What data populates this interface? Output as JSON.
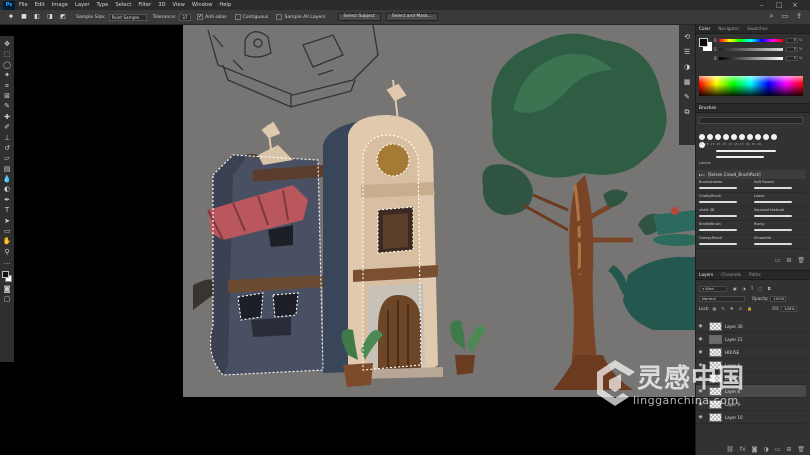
{
  "menu": {
    "logo": "Ps",
    "items": [
      "File",
      "Edit",
      "Image",
      "Layer",
      "Type",
      "Select",
      "Filter",
      "3D",
      "View",
      "Window",
      "Help"
    ]
  },
  "options": {
    "sample_size_label": "Sample Size:",
    "sample_size_value": "Point Sample",
    "tolerance_label": "Tolerance:",
    "tolerance_value": "37",
    "anti_alias_label": "Anti-alias",
    "contiguous_label": "Contiguous",
    "sample_all_layers_label": "Sample All Layers",
    "select_subject_label": "Select Subject",
    "select_and_mask_label": "Select and Mask..."
  },
  "color_panel": {
    "tabs": [
      "Color",
      "Navigator",
      "Swatches"
    ],
    "sliders": [
      {
        "label": "R",
        "value": "0"
      },
      {
        "label": "S",
        "value": "0"
      },
      {
        "label": "B",
        "value": "0"
      }
    ],
    "unit": "%"
  },
  "brushes_panel": {
    "tab": "Brushes",
    "preset_values": [
      "15",
      "15",
      "15",
      "15",
      "15",
      "15",
      "15",
      "15",
      "30",
      "30",
      "30"
    ],
    "group_label": "Labels",
    "subgroup": "[Kelsen Crowd_BrushPack]",
    "rows": [
      [
        "Brushstrokes",
        "Soft Round"
      ],
      [
        "ChalkyBrush",
        "Loose"
      ],
      [
        "chalk 38",
        "Squared textural"
      ],
      [
        "BristleBrush",
        "Rocky"
      ],
      [
        "GreasyPencil",
        "Smoothie"
      ]
    ]
  },
  "layers_panel": {
    "tabs": [
      "Layers",
      "Channels",
      "Paths"
    ],
    "filter_label": "Kind",
    "blend_mode": "Normal",
    "opacity_label": "Opacity:",
    "opacity_value": "100%",
    "lock_label": "Lock:",
    "fill_label": "Fill:",
    "fill_value": "100%",
    "layers": [
      {
        "name": "Layer 30",
        "selected": false,
        "dark": false
      },
      {
        "name": "Layer 21",
        "selected": false,
        "dark": true
      },
      {
        "name": "HOUSE",
        "selected": false,
        "dark": false
      },
      {
        "name": "Layer 6",
        "selected": false,
        "dark": false
      },
      {
        "name": "Layer 7",
        "selected": false,
        "dark": false
      },
      {
        "name": "Layer 8",
        "selected": true,
        "dark": false
      },
      {
        "name": "Layer 9",
        "selected": false,
        "dark": false
      },
      {
        "name": "Layer 10",
        "selected": false,
        "dark": false
      }
    ]
  },
  "watermark": {
    "title": "灵感中国",
    "url": "lingganchina.com"
  },
  "colors": {
    "canvas_bg": "#777574",
    "ui_dark": "#2b2b2b",
    "ui_panel": "#323232",
    "selected_layer": "#4a4a4a"
  }
}
